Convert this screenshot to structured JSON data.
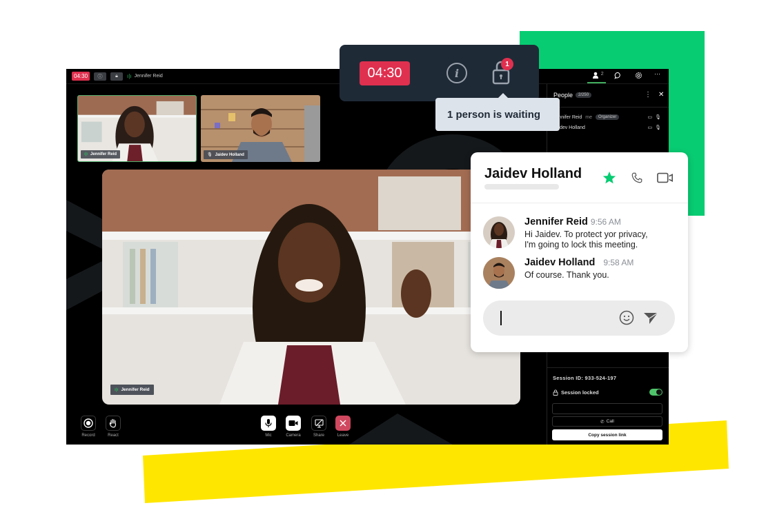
{
  "colors": {
    "accent_green": "#08cc72",
    "accent_yellow": "#ffe600",
    "timer_red": "#e0304f",
    "popup_bg": "#1f2a37",
    "tooltip_bg": "#dde3ea",
    "speaking_green": "#2fae5d"
  },
  "topbar": {
    "timer": "04:30",
    "info_icon": "info-icon",
    "lock_icon": "lock-icon",
    "active_speaker": "Jennifer Reid"
  },
  "timer_popup": {
    "timer": "04:30",
    "waiting_badge": "1",
    "tooltip": "1 person is waiting"
  },
  "participants": [
    {
      "name": "Jennifer Reid",
      "status_icon": "speaking-icon"
    },
    {
      "name": "Jaidev Holland",
      "status_icon": "mic-icon"
    }
  ],
  "main_video": {
    "label": "Jennifer Reid"
  },
  "sidebar": {
    "tabs": [
      {
        "icon": "people-icon",
        "count": "2",
        "active": true
      },
      {
        "icon": "chat-icon"
      },
      {
        "icon": "settings-icon"
      },
      {
        "icon": "more-icon",
        "label": "···"
      }
    ],
    "people_title": "People",
    "people_count": "2/250",
    "people": [
      {
        "name": "Jennifer Reid",
        "me": "me",
        "role": "Organizer"
      },
      {
        "name": "Jaidev Holland"
      }
    ],
    "session_id": "Session ID: 933-524-197",
    "session_locked_label": "Session locked",
    "session_locked": true,
    "call_label": "Call",
    "copy_link_label": "Copy session link"
  },
  "controls": {
    "left": [
      {
        "label": "Record",
        "icon": "record-icon"
      },
      {
        "label": "React",
        "icon": "hand-icon"
      }
    ],
    "center": [
      {
        "label": "Mic",
        "icon": "mic-icon"
      },
      {
        "label": "Camera",
        "icon": "camera-icon"
      },
      {
        "label": "Share",
        "icon": "share-screen-icon"
      },
      {
        "label": "Leave",
        "icon": "close-icon"
      }
    ]
  },
  "chat": {
    "contact_name": "Jaidev Holland",
    "messages": [
      {
        "sender": "Jennifer Reid",
        "time": "9:56 AM",
        "lines": [
          "Hi Jaidev. To protect yor privacy,",
          "I'm going to lock this meeting."
        ]
      },
      {
        "sender": "Jaidev Holland",
        "time": "9:58 AM",
        "lines": [
          "Of course. Thank you."
        ]
      }
    ],
    "composer_value": ""
  }
}
